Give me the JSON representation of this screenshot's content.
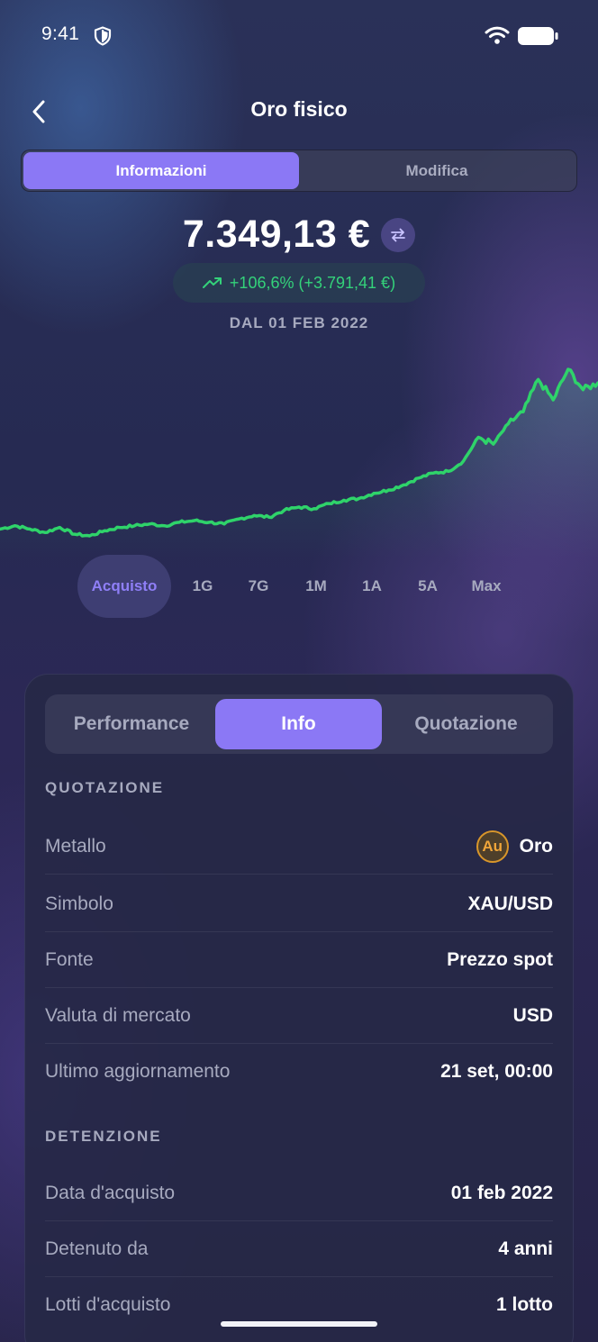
{
  "status_bar": {
    "time": "9:41"
  },
  "header": {
    "title": "Oro fisico"
  },
  "top_tabs": [
    {
      "label": "Informazioni",
      "active": true
    },
    {
      "label": "Modifica",
      "active": false
    }
  ],
  "summary": {
    "value": "7.349,13 €",
    "change": "+106,6% (+3.791,41 €)",
    "since": "DAL 01 FEB 2022"
  },
  "chart_data": {
    "type": "line",
    "color": "#2fd36a",
    "x": [
      "2022-02-01",
      "2022-03-01",
      "2022-04-01",
      "2022-05-01",
      "2022-06-01",
      "2022-07-01",
      "2022-08-01",
      "2022-09-01",
      "2022-10-01",
      "2022-11-01",
      "2022-12-01",
      "2023-01-01",
      "2023-02-01",
      "2023-03-01",
      "2023-04-01",
      "2023-05-01",
      "2023-06-01",
      "2023-07-01",
      "2023-08-01",
      "2023-09-01",
      "2023-10-01",
      "2023-11-01",
      "2023-12-01",
      "2024-01-01",
      "2024-02-01",
      "2024-03-01",
      "2024-04-01",
      "2024-05-01",
      "2024-06-01",
      "2024-07-01",
      "2024-08-01",
      "2024-09-01",
      "2024-10-01",
      "2024-11-01",
      "2024-12-01",
      "2025-01-01",
      "2025-02-01",
      "2025-03-01",
      "2025-04-01",
      "2025-05-01",
      "2025-06-01"
    ],
    "values": [
      100,
      102,
      100,
      98,
      101,
      97,
      96,
      99,
      101,
      102,
      103,
      102,
      104,
      105,
      104,
      103,
      106,
      108,
      107,
      111,
      113,
      112,
      115,
      117,
      118,
      121,
      123,
      126,
      130,
      133,
      134,
      140,
      154,
      150,
      162,
      169,
      188,
      176,
      194,
      182,
      186
    ],
    "title": "",
    "xlabel": "",
    "ylabel": ""
  },
  "ranges": [
    {
      "label": "Acquisto",
      "active": true
    },
    {
      "label": "1G"
    },
    {
      "label": "7G"
    },
    {
      "label": "1M"
    },
    {
      "label": "1A"
    },
    {
      "label": "5A"
    },
    {
      "label": "Max"
    }
  ],
  "detail_tabs": [
    {
      "label": "Performance"
    },
    {
      "label": "Info",
      "active": true
    },
    {
      "label": "Quotazione"
    }
  ],
  "quotazione": {
    "heading": "QUOTAZIONE",
    "rows": [
      {
        "key": "Metallo",
        "value": "Oro",
        "badge": "Au"
      },
      {
        "key": "Simbolo",
        "value": "XAU/USD"
      },
      {
        "key": "Fonte",
        "value": "Prezzo spot"
      },
      {
        "key": "Valuta di mercato",
        "value": "USD"
      },
      {
        "key": "Ultimo aggiornamento",
        "value": "21 set, 00:00"
      }
    ]
  },
  "detenzione": {
    "heading": "DETENZIONE",
    "rows": [
      {
        "key": "Data d'acquisto",
        "value": "01 feb 2022"
      },
      {
        "key": "Detenuto da",
        "value": "4 anni"
      },
      {
        "key": "Lotti d'acquisto",
        "value": "1 lotto"
      }
    ]
  },
  "colors": {
    "accent": "#8b78f5",
    "positive": "#34d27a",
    "gold": "#d8962a"
  }
}
